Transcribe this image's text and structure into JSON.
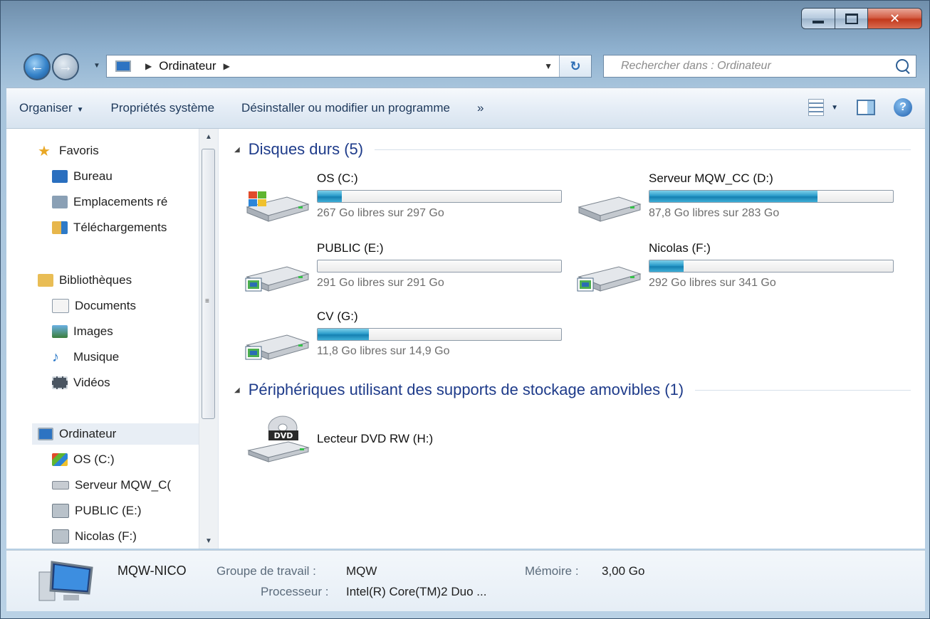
{
  "address": {
    "crumbs": [
      "Ordinateur"
    ],
    "search_placeholder": "Rechercher dans : Ordinateur"
  },
  "toolbar": {
    "organize_label": "Organiser",
    "system_properties_label": "Propriétés système",
    "uninstall_label": "Désinstaller ou modifier un programme",
    "more_label": "»"
  },
  "navpane": {
    "favorites": {
      "label": "Favoris",
      "items": [
        "Bureau",
        "Emplacements ré",
        "Téléchargements"
      ]
    },
    "libraries": {
      "label": "Bibliothèques",
      "items": [
        "Documents",
        "Images",
        "Musique",
        "Vidéos"
      ]
    },
    "computer": {
      "label": "Ordinateur",
      "items": [
        "OS (C:)",
        "Serveur MQW_C(",
        "PUBLIC (E:)",
        "Nicolas (F:)"
      ]
    }
  },
  "groups": {
    "hard_drives": {
      "title": "Disques durs (5)",
      "drives": [
        {
          "name": "OS (C:)",
          "free_text": "267 Go libres sur 297 Go",
          "used_fraction": 0.1
        },
        {
          "name": "Serveur MQW_CC (D:)",
          "free_text": "87,8 Go libres sur 283 Go",
          "used_fraction": 0.69
        },
        {
          "name": "PUBLIC (E:)",
          "free_text": "291 Go libres sur 291 Go",
          "used_fraction": 0.0
        },
        {
          "name": "Nicolas (F:)",
          "free_text": "292 Go libres sur 341 Go",
          "used_fraction": 0.14
        },
        {
          "name": "CV (G:)",
          "free_text": "11,8 Go libres sur 14,9 Go",
          "used_fraction": 0.21
        }
      ]
    },
    "removable": {
      "title": "Périphériques utilisant des supports de stockage amovibles (1)",
      "devices": [
        {
          "name": "Lecteur DVD RW (H:)",
          "icon_text": "DVD"
        }
      ]
    }
  },
  "details": {
    "computer_name": "MQW-NICO",
    "workgroup_label": "Groupe de travail :",
    "workgroup_value": "MQW",
    "memory_label": "Mémoire :",
    "memory_value": "3,00 Go",
    "processor_label": "Processeur :",
    "processor_value": "Intel(R) Core(TM)2 Duo ..."
  },
  "colors": {
    "accent": "#1e3b8a",
    "bar_fill": "#2b9ccb"
  }
}
